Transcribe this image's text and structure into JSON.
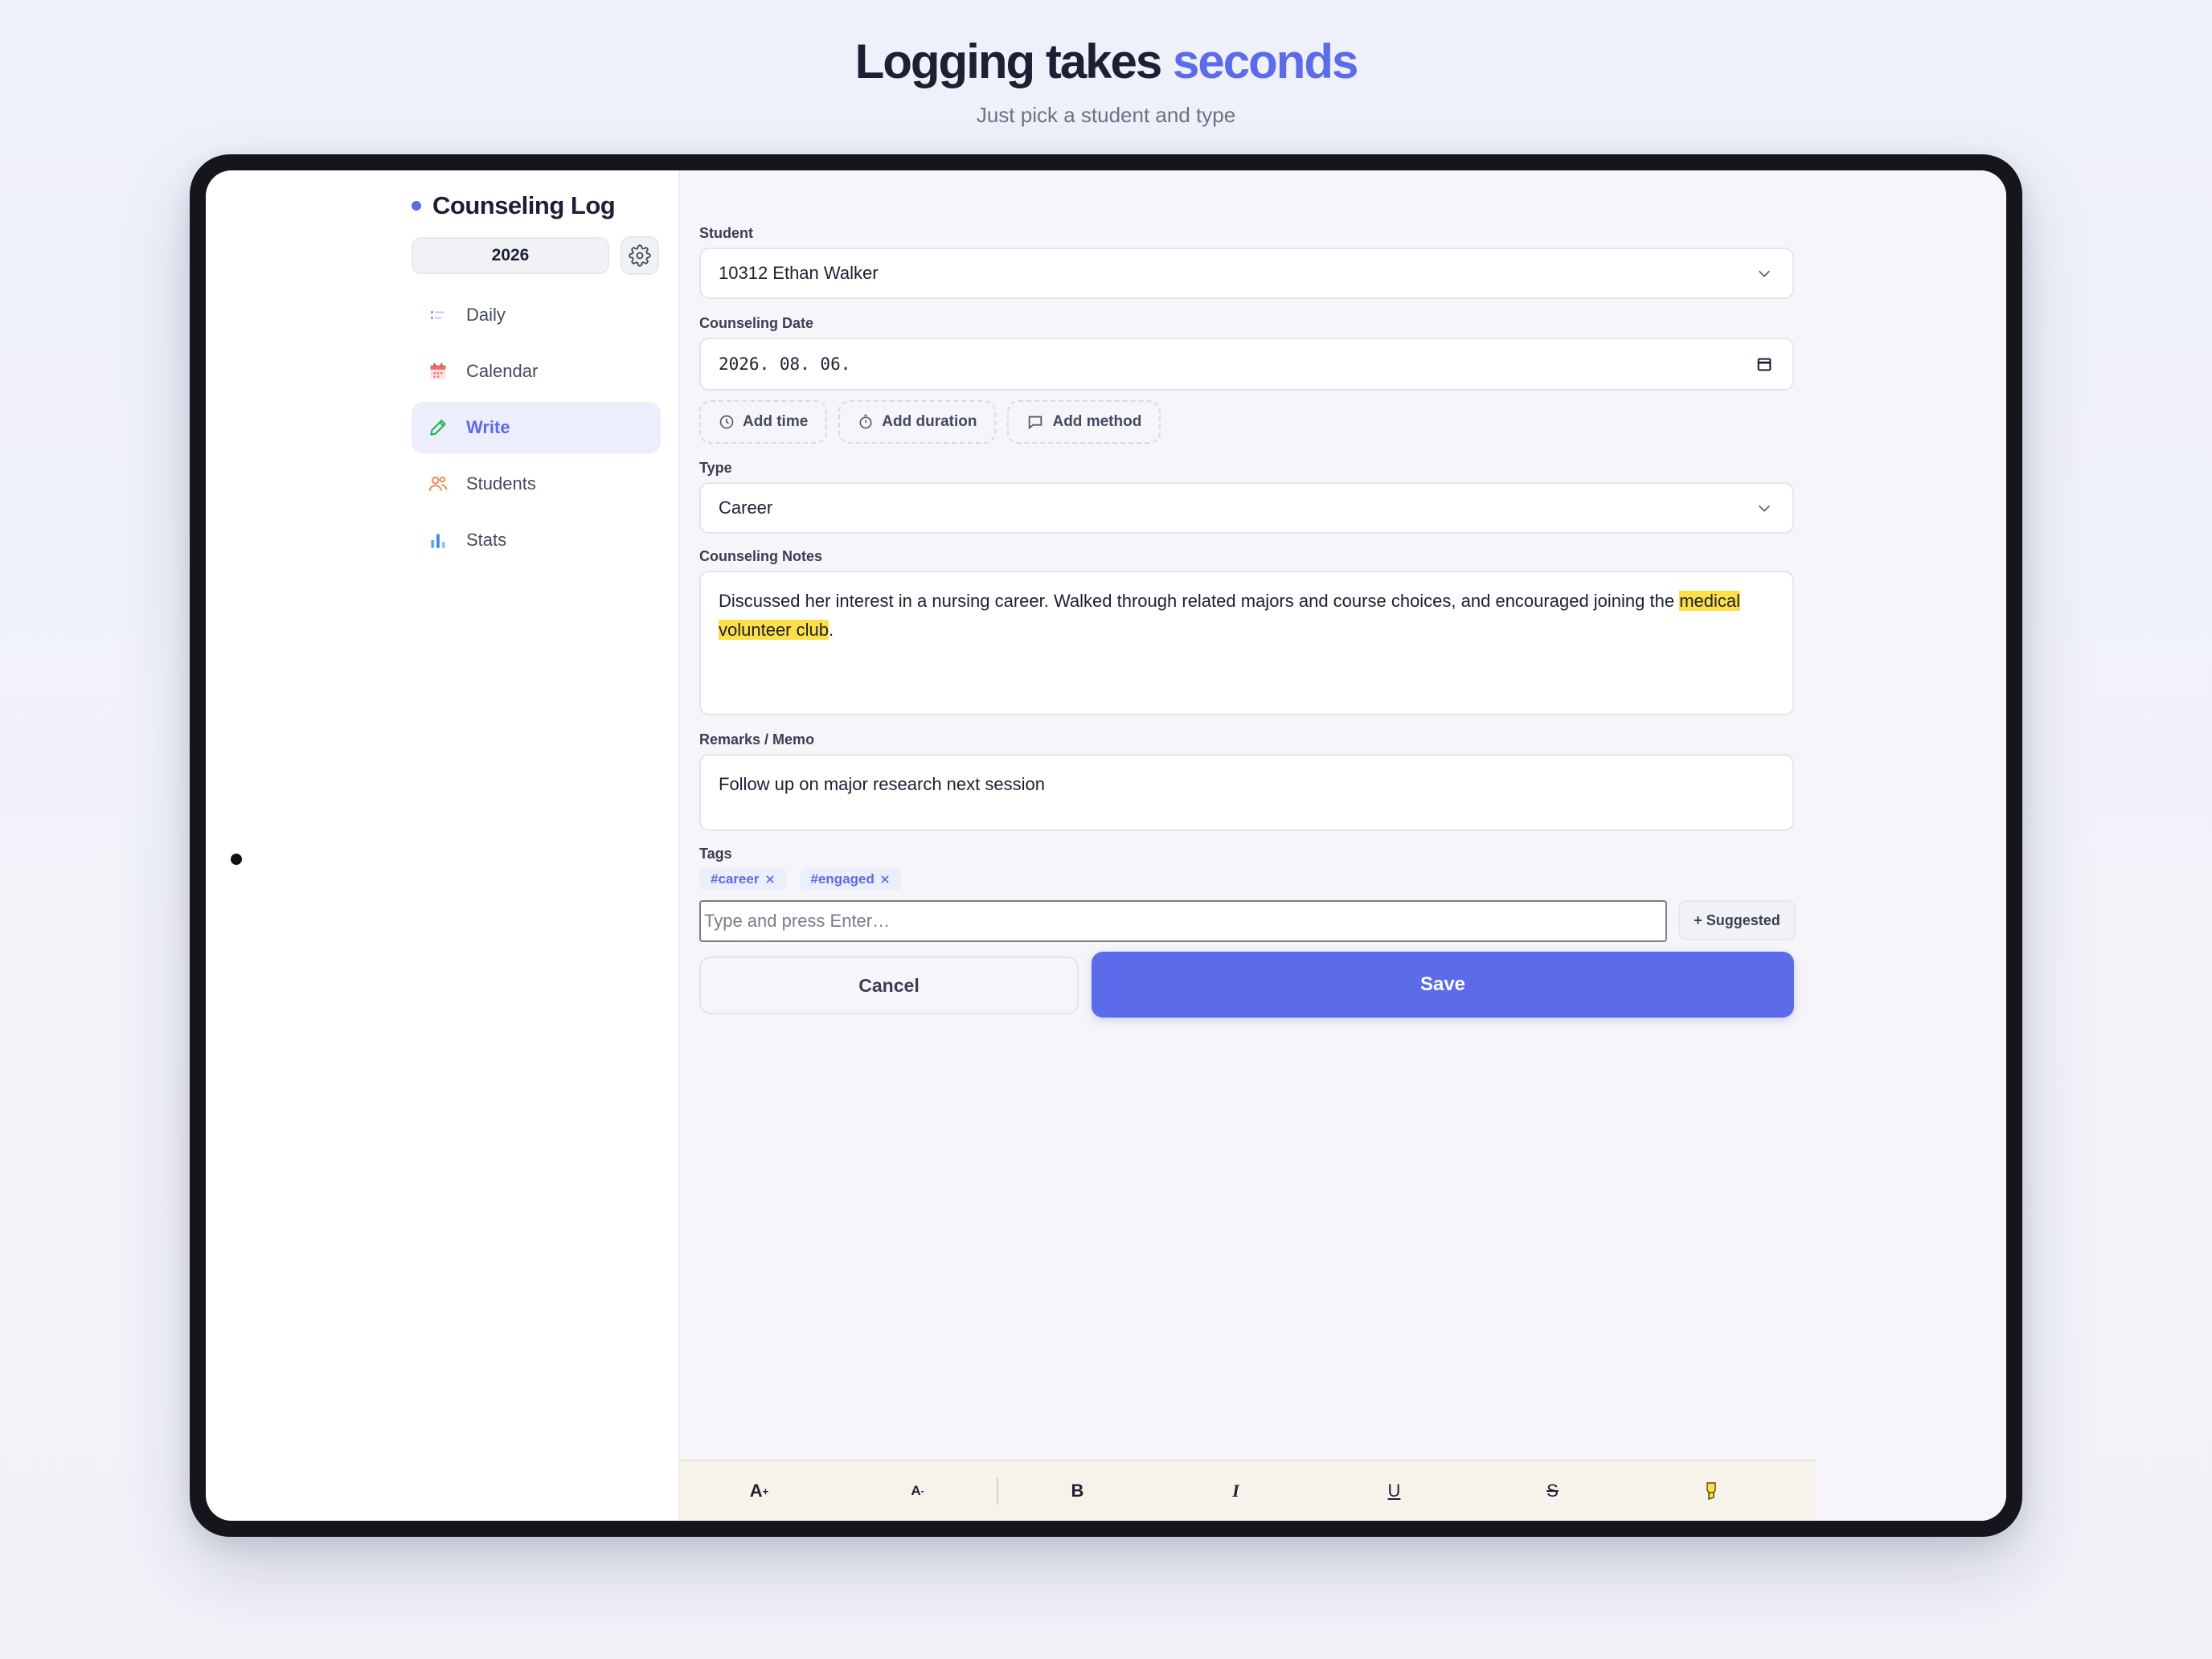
{
  "hero": {
    "title_main": "Logging takes ",
    "title_accent": "seconds",
    "subtitle": "Just pick a student and type"
  },
  "sidebar": {
    "brand": "Counseling Log",
    "year": "2026",
    "items": [
      {
        "label": "Daily",
        "icon": "list-icon",
        "active": false
      },
      {
        "label": "Calendar",
        "icon": "calendar-icon",
        "active": false
      },
      {
        "label": "Write",
        "icon": "pencil-icon",
        "active": true
      },
      {
        "label": "Students",
        "icon": "users-icon",
        "active": false
      },
      {
        "label": "Stats",
        "icon": "bar-chart-icon",
        "active": false
      }
    ]
  },
  "form": {
    "student_label": "Student",
    "student_value": "10312 Ethan Walker",
    "date_label": "Counseling Date",
    "date_value": "2026. 08. 06.",
    "chips": {
      "add_time": "Add time",
      "add_duration": "Add duration",
      "add_method": "Add method"
    },
    "type_label": "Type",
    "type_value": "Career",
    "notes_label": "Counseling Notes",
    "notes_before": "Discussed her interest in a nursing career. Walked through related majors and course choices, and encouraged joining the ",
    "notes_highlight": "medical volunteer club",
    "notes_after": ".",
    "remarks_label": "Remarks / Memo",
    "remarks_value": "Follow up on major research next session",
    "tags_label": "Tags",
    "tags": [
      "#career",
      "#engaged"
    ],
    "tag_placeholder": "Type and press Enter…",
    "suggested_label": "+ Suggested",
    "cancel_label": "Cancel",
    "save_label": "Save"
  },
  "format_bar": {
    "font_up": "A",
    "font_up_sup": "+",
    "font_down": "A",
    "font_down_sup": "-",
    "bold": "B",
    "italic": "I",
    "underline": "U",
    "strike": "S"
  },
  "colors": {
    "accent": "#5b6bea",
    "highlight": "#fde047"
  }
}
